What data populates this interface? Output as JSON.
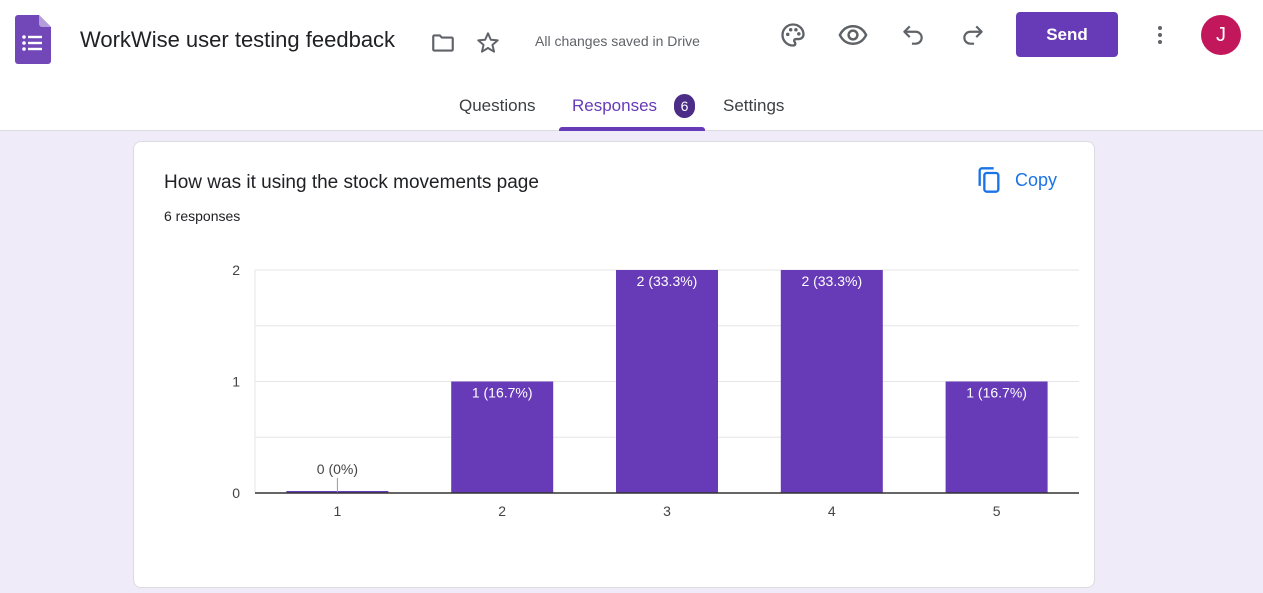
{
  "header": {
    "title": "WorkWise user testing feedback",
    "save_status": "All changes saved in Drive",
    "send_label": "Send",
    "avatar_letter": "J",
    "icons": [
      "forms-app-icon",
      "folder-icon",
      "star-icon",
      "palette-icon",
      "eye-icon",
      "undo-icon",
      "redo-icon",
      "more-vert-icon"
    ]
  },
  "tabs": [
    {
      "label": "Questions"
    },
    {
      "label": "Responses",
      "badge": "6",
      "active": true
    },
    {
      "label": "Settings"
    }
  ],
  "card": {
    "question": "How was it using the stock movements page",
    "responses": "6 responses",
    "copy_label": "Copy"
  },
  "colors": {
    "accent": "#673ab7",
    "background": "#f0ebf8",
    "avatar": "#c2185b",
    "link": "#1a73e8"
  },
  "chart_data": {
    "type": "bar",
    "categories": [
      "1",
      "2",
      "3",
      "4",
      "5"
    ],
    "values": [
      0,
      1,
      2,
      2,
      1
    ],
    "labels": [
      "0 (0%)",
      "1 (16.7%)",
      "2 (33.3%)",
      "2 (33.3%)",
      "1 (16.7%)"
    ],
    "yticks": [
      "0",
      "1",
      "2"
    ],
    "ylim": [
      0,
      2
    ],
    "grid": true,
    "color": "#673ab7"
  }
}
